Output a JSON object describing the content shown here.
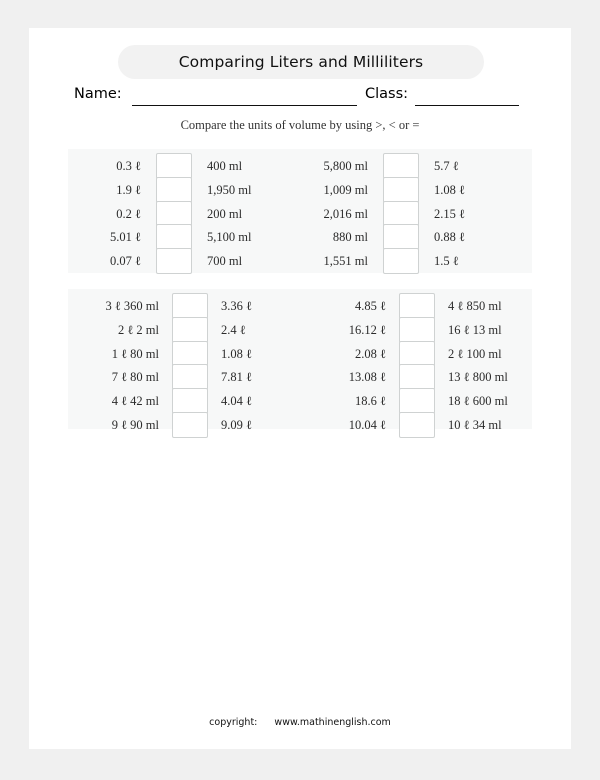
{
  "header": {
    "title": "Comparing Liters and Milliliters",
    "name_label": "Name:",
    "class_label": "Class:",
    "instruction": "Compare the units of volume by using >, < or ="
  },
  "blocks": [
    {
      "id": "block-1",
      "rows": [
        {
          "left_a": "0.3 ℓ",
          "left_b": "400 ml",
          "right_a": "5,800 ml",
          "right_b": "5.7  ℓ"
        },
        {
          "left_a": "1.9 ℓ",
          "left_b": "1,950 ml",
          "right_a": "1,009 ml",
          "right_b": "1.08 ℓ"
        },
        {
          "left_a": "0.2 ℓ",
          "left_b": "200 ml",
          "right_a": "2,016 ml",
          "right_b": "2.15 ℓ"
        },
        {
          "left_a": "5.01 ℓ",
          "left_b": "5,100 ml",
          "right_a": "880 ml",
          "right_b": "0.88 ℓ"
        },
        {
          "left_a": "0.07 ℓ",
          "left_b": "700 ml",
          "right_a": "1,551 ml",
          "right_b": "1.5  ℓ"
        }
      ]
    },
    {
      "id": "block-2",
      "rows": [
        {
          "left_a": "3 ℓ 360 ml",
          "left_b": "3.36 ℓ",
          "right_a": "4.85 ℓ",
          "right_b": "4 ℓ 850 ml"
        },
        {
          "left_a": "2 ℓ   2 ml",
          "left_b": "2.4  ℓ",
          "right_a": "16.12 ℓ",
          "right_b": "16 ℓ  13 ml"
        },
        {
          "left_a": "1 ℓ  80 ml",
          "left_b": "1.08 ℓ",
          "right_a": "2.08 ℓ",
          "right_b": "2 ℓ 100 ml"
        },
        {
          "left_a": "7 ℓ  80 ml",
          "left_b": "7.81 ℓ",
          "right_a": "13.08 ℓ",
          "right_b": "13 ℓ 800 ml"
        },
        {
          "left_a": "4 ℓ  42 ml",
          "left_b": "4.04 ℓ",
          "right_a": "18.6  ℓ",
          "right_b": "18 ℓ 600 ml"
        },
        {
          "left_a": "9 ℓ  90 ml",
          "left_b": "9.09 ℓ",
          "right_a": "10.04 ℓ",
          "right_b": "10 ℓ  34 ml"
        }
      ]
    }
  ],
  "footer": {
    "copyright_label": "copyright:",
    "site": "www.mathinenglish.com"
  },
  "colors": {
    "page_margin": "#f0f0f0",
    "paper": "#ffffff",
    "block_background": "#f7f8f8",
    "title_pill": "#f2f2f2",
    "box_border": "#cfd2d2",
    "text": "#2b2b2b"
  }
}
